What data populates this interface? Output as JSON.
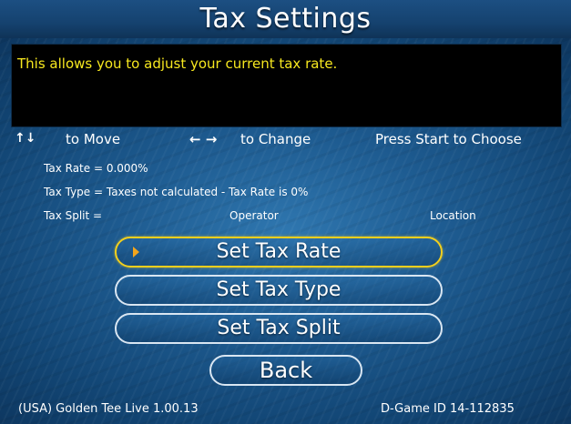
{
  "header": {
    "title": "Tax Settings"
  },
  "description": "This allows you to adjust your current tax rate.",
  "controls": {
    "move_icon": "↑↓",
    "move_label": "to Move",
    "change_icon": "← →",
    "change_label": "to Change",
    "start_label": "Press Start to Choose"
  },
  "info": {
    "tax_rate": "Tax Rate = 0.000%",
    "tax_type": "Tax Type = Taxes not calculated - Tax Rate is 0%",
    "tax_split_label": "Tax Split =",
    "tax_split_operator": "Operator",
    "tax_split_location": "Location"
  },
  "menu": {
    "items": [
      {
        "label": "Set Tax Rate",
        "selected": true
      },
      {
        "label": "Set Tax Type",
        "selected": false
      },
      {
        "label": "Set Tax Split",
        "selected": false
      },
      {
        "label": "Back",
        "selected": false
      }
    ]
  },
  "footer": {
    "version": "(USA) Golden Tee Live 1.00.13",
    "game_id": "D-Game ID 14-112835"
  },
  "colors": {
    "accent_yellow": "#f7e81f",
    "selection_border": "#f2cf1d",
    "background_blue": "#1d5a8f"
  }
}
